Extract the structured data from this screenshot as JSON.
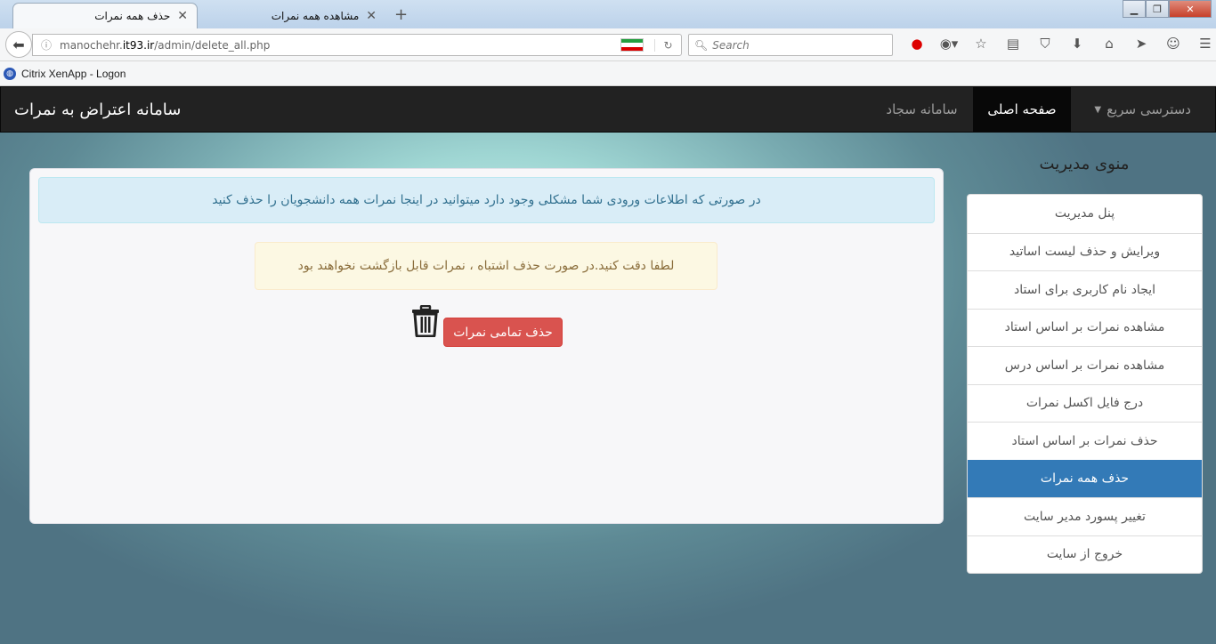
{
  "browser": {
    "tabs": [
      {
        "title": "حذف همه نمرات",
        "active": true
      },
      {
        "title": "مشاهده همه نمرات",
        "active": false
      }
    ],
    "url_prefix": "manochehr.",
    "url_domain": "it93.ir",
    "url_path": "/admin/delete_all.php",
    "search_placeholder": "Search",
    "bookmark": "Citrix XenApp - Logon",
    "icons": [
      "back-icon",
      "info-icon",
      "flag-icon",
      "reload-icon",
      "search-icon",
      "record-icon",
      "addon-icon",
      "star-icon",
      "reader-icon",
      "pocket-icon",
      "download-icon",
      "home-icon",
      "send-icon",
      "smiley-icon",
      "menu-icon"
    ]
  },
  "navbar": {
    "brand": "سامانه اعتراض به نمرات",
    "items": [
      {
        "label": "دسترسی سریع"
      },
      {
        "label": "صفحه اصلی"
      },
      {
        "label": "سامانه سجاد"
      }
    ]
  },
  "sidebar": {
    "heading": "منوی مدیریت",
    "items": [
      {
        "label": "پنل مدیریت"
      },
      {
        "label": "ویرایش و حذف لیست اساتید"
      },
      {
        "label": "ایجاد نام کاربری برای استاد"
      },
      {
        "label": "مشاهده نمرات بر اساس استاد"
      },
      {
        "label": "مشاهده نمرات بر اساس درس"
      },
      {
        "label": "درج فایل اکسل نمرات"
      },
      {
        "label": "حذف نمرات بر اساس استاد"
      },
      {
        "label": "حذف همه نمرات"
      },
      {
        "label": "تغییر پسورد مدیر سایت"
      },
      {
        "label": "خروج از سایت"
      }
    ],
    "active_index": 7
  },
  "main": {
    "info_text": "در صورتی که اطلاعات ورودی شما مشکلی وجود دارد میتوانید در اینجا نمرات همه دانشجویان را حذف کنید",
    "warning_text": "لطفا دقت کنید.در صورت حذف اشتباه ، نمرات قابل بازگشت نخواهند بود",
    "delete_button": "حذف تمامی نمرات"
  },
  "colors": {
    "navbar": "#222222",
    "active_menu": "#337ab7",
    "danger": "#d9534f",
    "info_bg": "#d9edf7",
    "warning_bg": "#fcf8e3"
  }
}
